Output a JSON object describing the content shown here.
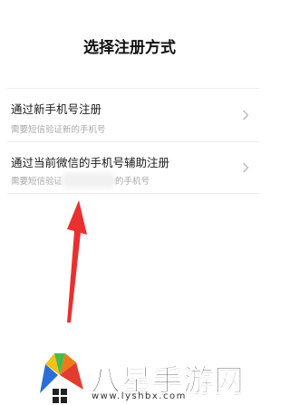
{
  "header": {
    "title": "选择注册方式"
  },
  "options": [
    {
      "title": "通过新手机号注册",
      "subtitle": "需要短信验证新的手机号"
    },
    {
      "title": "通过当前微信的手机号辅助注册",
      "subtitle_prefix": "需要短信验证",
      "subtitle_suffix": "的手机号"
    }
  ],
  "watermark": {
    "name": "八星手游网",
    "url": "www.lyshbx.com"
  },
  "colors": {
    "arrow": "#e8312e",
    "text": "#1a1a1a",
    "subtext": "#a8a8a8",
    "divider": "#ececec"
  },
  "icons": {
    "row_chevron": "chevron-right-icon",
    "annotation": "red-arrow-up-icon"
  }
}
